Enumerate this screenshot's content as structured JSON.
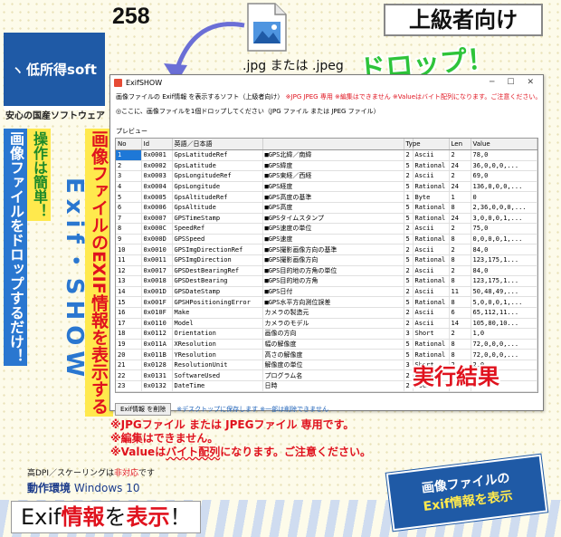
{
  "brand": {
    "logo": "低所得soft",
    "tagline": "安心の国産ソフトウェア"
  },
  "header": {
    "number": "258",
    "level": "上級者向け"
  },
  "drop": {
    "file_types": ".jpg または .jpeg",
    "drop_label": "ドロップ！"
  },
  "side": {
    "col_drop": "画像ファイルをドロップするだけ！",
    "col_easy": "操作は簡単！",
    "col_exif": "Exif・SHOW",
    "col_show": "画像ファイルのEXIF情報を表示する"
  },
  "window": {
    "title": "ExifSHOW",
    "info1_normal": "画像ファイルの Exif情報 を表示するソフト（上級者向け）",
    "info1_red": "※JPG JPEG 専用 ※編集はできません ※Valueはバイト配列になります。ご注意ください。",
    "info2": "◎ここに、画像ファイルを1個ドロップしてください（JPG ファイル または JPEG ファイル）",
    "preview_label": "プレビュー",
    "columns": [
      "No",
      "Id",
      "英語／日本語",
      "",
      "Type",
      "",
      "Len",
      "Value"
    ],
    "rows": [
      [
        "1",
        "0x0001",
        "GpsLatitudeRef",
        "■GPS北緯／南緯",
        "2",
        "Ascii",
        "2",
        "78,0"
      ],
      [
        "2",
        "0x0002",
        "GpsLatitude",
        "■GPS緯度",
        "5",
        "Rational",
        "24",
        "36,0,0,0,..."
      ],
      [
        "3",
        "0x0003",
        "GpsLongitudeRef",
        "■GPS東経／西経",
        "2",
        "Ascii",
        "2",
        "69,0"
      ],
      [
        "4",
        "0x0004",
        "GpsLongitude",
        "■GPS経度",
        "5",
        "Rational",
        "24",
        "136,0,0,0,..."
      ],
      [
        "5",
        "0x0005",
        "GpsAltitudeRef",
        "■GPS高度の基準",
        "1",
        "Byte",
        "1",
        "0"
      ],
      [
        "6",
        "0x0006",
        "GpsAltitude",
        "■GPS高度",
        "5",
        "Rational",
        "8",
        "2,36,0,0,0,..."
      ],
      [
        "7",
        "0x0007",
        "GPSTimeStamp",
        "■GPSタイムスタンプ",
        "5",
        "Rational",
        "24",
        "3,0,0,0,1,..."
      ],
      [
        "8",
        "0x000C",
        "SpeedRef",
        "■GPS速度の単位",
        "2",
        "Ascii",
        "2",
        "75,0"
      ],
      [
        "9",
        "0x000D",
        "GPSSpeed",
        "■GPS速度",
        "5",
        "Rational",
        "8",
        "0,0,0,0,1,..."
      ],
      [
        "10",
        "0x0010",
        "GPSImgDirectionRef",
        "■GPS撮影画像方向の基準",
        "2",
        "Ascii",
        "2",
        "84,0"
      ],
      [
        "11",
        "0x0011",
        "GPSImgDirection",
        "■GPS撮影画像方向",
        "5",
        "Rational",
        "8",
        "123,175,1..."
      ],
      [
        "12",
        "0x0017",
        "GPSDestBearingRef",
        "■GPS目的地の方角の単位",
        "2",
        "Ascii",
        "2",
        "84,0"
      ],
      [
        "13",
        "0x0018",
        "GPSDestBearing",
        "■GPS目的地の方角",
        "5",
        "Rational",
        "8",
        "123,175,1..."
      ],
      [
        "14",
        "0x001D",
        "GPSDateStamp",
        "■GPS日付",
        "2",
        "Ascii",
        "11",
        "50,48,49,..."
      ],
      [
        "15",
        "0x001F",
        "GPSHPositioningError",
        "■GPS水平方向測位誤差",
        "5",
        "Rational",
        "8",
        "5,0,0,0,1,..."
      ],
      [
        "16",
        "0x010F",
        "Make",
        "カメラの製造元",
        "2",
        "Ascii",
        "6",
        "65,112,11..."
      ],
      [
        "17",
        "0x0110",
        "Model",
        "カメラのモデル",
        "2",
        "Ascii",
        "14",
        "105,80,10..."
      ],
      [
        "18",
        "0x0112",
        "Orientation",
        "画像の方向",
        "3",
        "Short",
        "2",
        "1,0"
      ],
      [
        "19",
        "0x011A",
        "XResolution",
        "幅の解像度",
        "5",
        "Rational",
        "8",
        "72,0,0,0,..."
      ],
      [
        "20",
        "0x011B",
        "YResolution",
        "高さの解像度",
        "5",
        "Rational",
        "8",
        "72,0,0,0,..."
      ],
      [
        "21",
        "0x0128",
        "ResolutionUnit",
        "解像度の単位",
        "3",
        "Short",
        "2",
        "2,0"
      ],
      [
        "22",
        "0x0131",
        "SoftwareUsed",
        "プログラム名",
        "2",
        "Ascii",
        "",
        ""
      ],
      [
        "23",
        "0x0132",
        "DateTime",
        "日時",
        "2",
        "Ascii",
        "",
        ""
      ]
    ],
    "footer_button": "Exif情報 を削除",
    "footer_note": "※デスクトップに保存します ※一部は削除できません"
  },
  "result_label": "実行結果",
  "notes": {
    "line1": "※JPGファイル または JPEGファイル 専用です。",
    "line2": "※編集はできません。",
    "line3_pre": "※Valueは",
    "line3_wavy": "バイト配列",
    "line3_post": "になります。ご注意ください。"
  },
  "hdpi": {
    "pre": "高DPI／スケーリングは",
    "red": "非対応",
    "post": "です"
  },
  "env": {
    "label": "動作環境",
    "os": "Windows 10"
  },
  "bottom": {
    "pre": "Exif",
    "red1": "情報",
    "mid": "を",
    "red2": "表示",
    "post": "！"
  },
  "banner": {
    "line1": "画像ファイルの",
    "line2": "Exif情報を表示"
  },
  "colors": {
    "accent_blue": "#1f5aa6",
    "red": "#e0121e",
    "green": "#2ec43a",
    "yellow": "#ffe94d",
    "selection": "#1e78d7"
  },
  "icons": [
    "jpg-file-icon",
    "app-icon",
    "minimize-icon",
    "maximize-icon",
    "close-icon",
    "curved-arrow-icon"
  ]
}
